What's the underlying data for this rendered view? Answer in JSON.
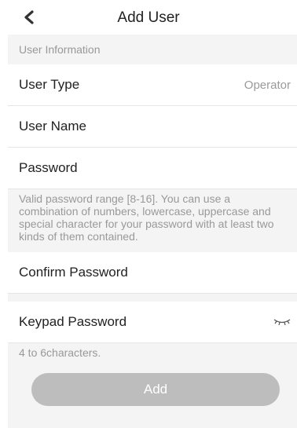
{
  "header": {
    "title": "Add User"
  },
  "section": {
    "title": "User Information"
  },
  "fields": {
    "user_type_label": "User Type",
    "user_type_value": "Operator",
    "user_name_label": "User Name",
    "password_label": "Password",
    "password_hint": "Valid password range [8-16]. You can use a combination of numbers, lowercase, uppercase and special character for your password with at least two kinds of them contained.",
    "confirm_password_label": "Confirm Password",
    "keypad_password_label": "Keypad Password",
    "keypad_password_hint": "4 to 6characters."
  },
  "actions": {
    "add_label": "Add"
  },
  "colors": {
    "background_gray": "#f4f4f4",
    "disabled_button": "#bdbdbd",
    "secondary_text": "#999999"
  },
  "icons": {
    "back": "chevron-left-icon",
    "visibility": "eye-closed-icon"
  }
}
